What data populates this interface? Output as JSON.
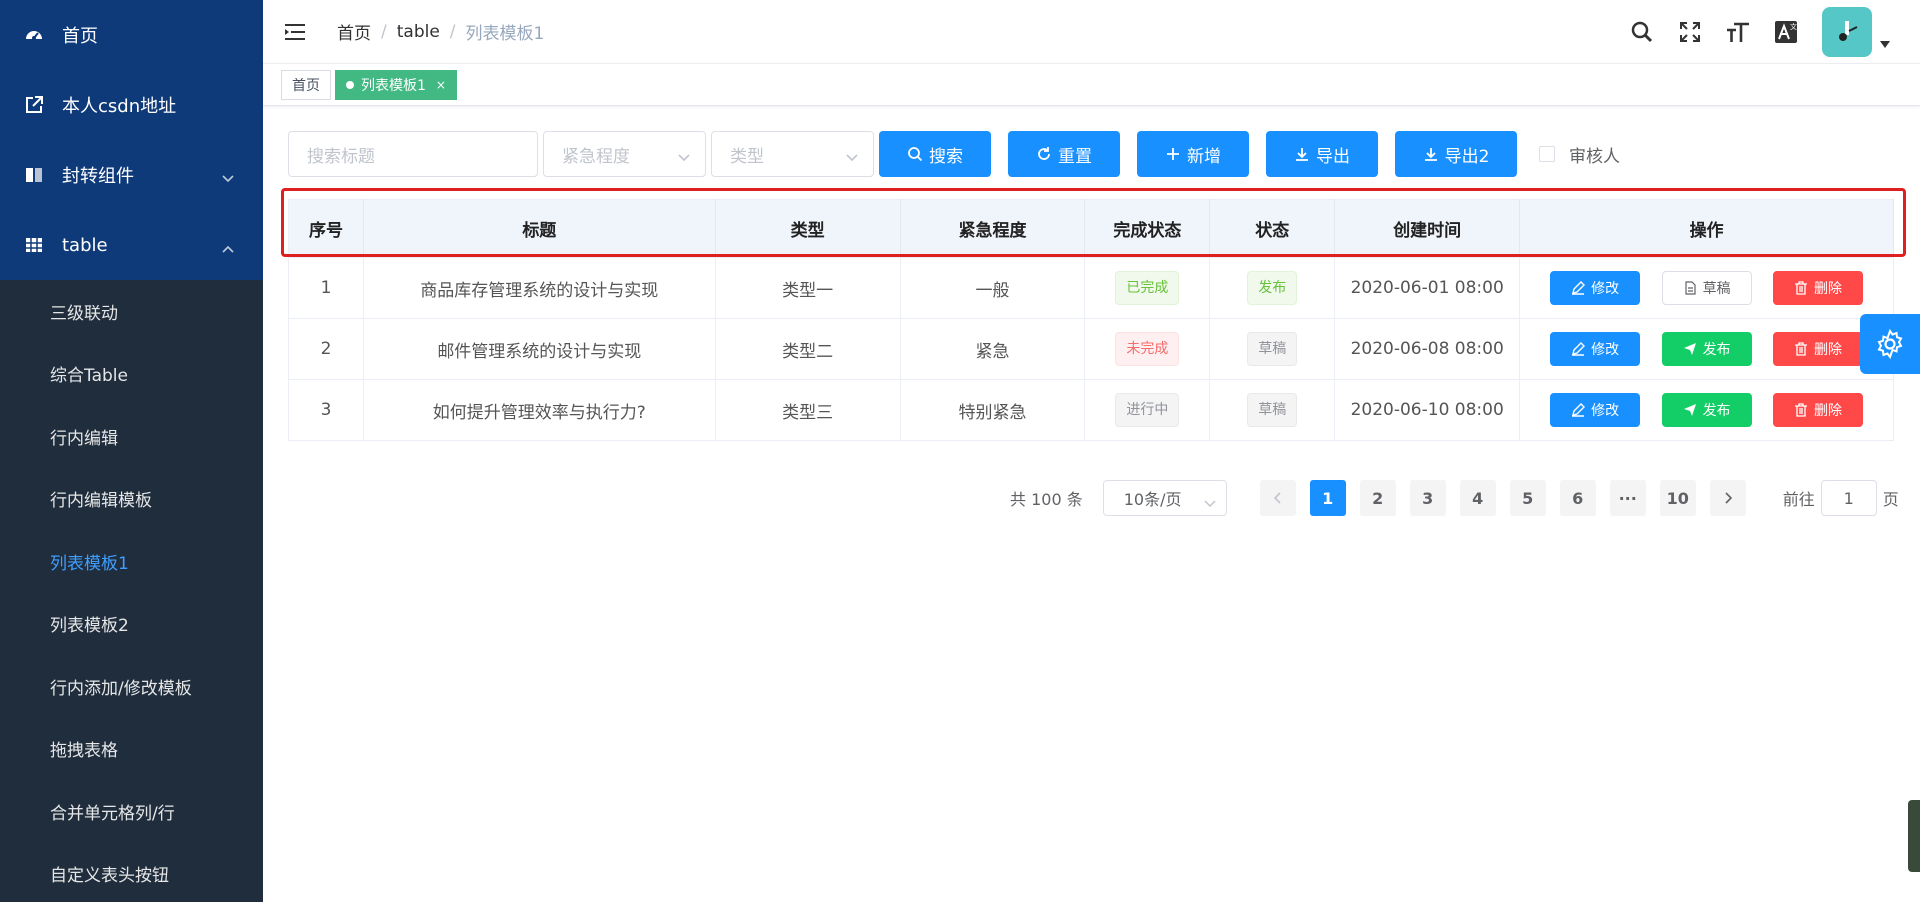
{
  "sidebar": {
    "top_items": [
      {
        "label": "首页",
        "icon": "dashboard-icon"
      },
      {
        "label": "本人csdn地址",
        "icon": "external-link-icon"
      },
      {
        "label": "封转组件",
        "icon": "book-icon"
      },
      {
        "label": "table",
        "icon": "table-icon"
      }
    ],
    "sub_items": [
      {
        "label": "三级联动"
      },
      {
        "label": "综合Table"
      },
      {
        "label": "行内编辑"
      },
      {
        "label": "行内编辑模板"
      },
      {
        "label": "列表模板1"
      },
      {
        "label": "列表模板2"
      },
      {
        "label": "行内添加/修改模板"
      },
      {
        "label": "拖拽表格"
      },
      {
        "label": "合并单元格列/行"
      },
      {
        "label": "自定义表头按钮"
      }
    ],
    "active_sub": "列表模板1"
  },
  "header": {
    "breadcrumb": [
      "首页",
      "table",
      "列表模板1"
    ],
    "breadcrumb_sep": "/"
  },
  "tags": {
    "home": "首页",
    "active": "列表模板1",
    "close": "×"
  },
  "filters": {
    "search_placeholder": "搜索标题",
    "urgency_placeholder": "紧急程度",
    "type_placeholder": "类型",
    "search_btn": "搜索",
    "reset_btn": "重置",
    "add_btn": "新增",
    "export_btn": "导出",
    "export2_btn": "导出2",
    "reviewer_label": "审核人"
  },
  "table": {
    "columns": [
      "序号",
      "标题",
      "类型",
      "紧急程度",
      "完成状态",
      "状态",
      "创建时间",
      "操作"
    ],
    "rows": [
      {
        "index": "1",
        "title": "商品库存管理系统的设计与实现",
        "type": "类型一",
        "urgency": "一般",
        "completion": "已完成",
        "status": "发布",
        "created": "2020-06-01 08:00",
        "second_action": "草稿"
      },
      {
        "index": "2",
        "title": "邮件管理系统的设计与实现",
        "type": "类型二",
        "urgency": "紧急",
        "completion": "未完成",
        "status": "草稿",
        "created": "2020-06-08 08:00",
        "second_action": "发布"
      },
      {
        "index": "3",
        "title": "如何提升管理效率与执行力?",
        "type": "类型三",
        "urgency": "特别紧急",
        "completion": "进行中",
        "status": "草稿",
        "created": "2020-06-10 08:00",
        "second_action": "发布"
      }
    ],
    "edit_label": "修改",
    "delete_label": "删除"
  },
  "pagination": {
    "total": "共 100 条",
    "page_size": "10条/页",
    "pages": [
      "1",
      "2",
      "3",
      "4",
      "5",
      "6",
      "···",
      "10"
    ],
    "current": "1",
    "goto_prefix": "前往",
    "goto_value": "1",
    "goto_suffix": "页"
  },
  "colors": {
    "primary": "#1890ff",
    "success": "#13ce66",
    "danger": "#ff4949",
    "sidebar_bg": "#1f2d3d",
    "sidebar_top_bg": "#0f3a7a",
    "tag_active": "#42b983"
  }
}
